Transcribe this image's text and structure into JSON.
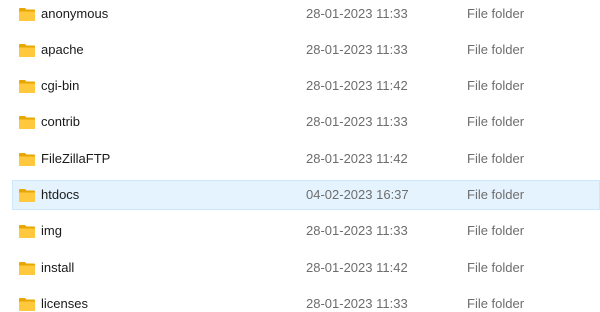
{
  "icon": "folder-icon",
  "colors": {
    "folder_back": "#e8a700",
    "folder_front": "#ffc83d",
    "selected_bg": "#e5f3ff",
    "selected_border": "#cce8ff"
  },
  "files": [
    {
      "name": "anonymous",
      "date": "28-01-2023 11:33",
      "type": "File folder",
      "selected": false
    },
    {
      "name": "apache",
      "date": "28-01-2023 11:33",
      "type": "File folder",
      "selected": false
    },
    {
      "name": "cgi-bin",
      "date": "28-01-2023 11:42",
      "type": "File folder",
      "selected": false
    },
    {
      "name": "contrib",
      "date": "28-01-2023 11:33",
      "type": "File folder",
      "selected": false
    },
    {
      "name": "FileZillaFTP",
      "date": "28-01-2023 11:42",
      "type": "File folder",
      "selected": false
    },
    {
      "name": "htdocs",
      "date": "04-02-2023 16:37",
      "type": "File folder",
      "selected": true
    },
    {
      "name": "img",
      "date": "28-01-2023 11:33",
      "type": "File folder",
      "selected": false
    },
    {
      "name": "install",
      "date": "28-01-2023 11:42",
      "type": "File folder",
      "selected": false
    },
    {
      "name": "licenses",
      "date": "28-01-2023 11:33",
      "type": "File folder",
      "selected": false
    }
  ]
}
